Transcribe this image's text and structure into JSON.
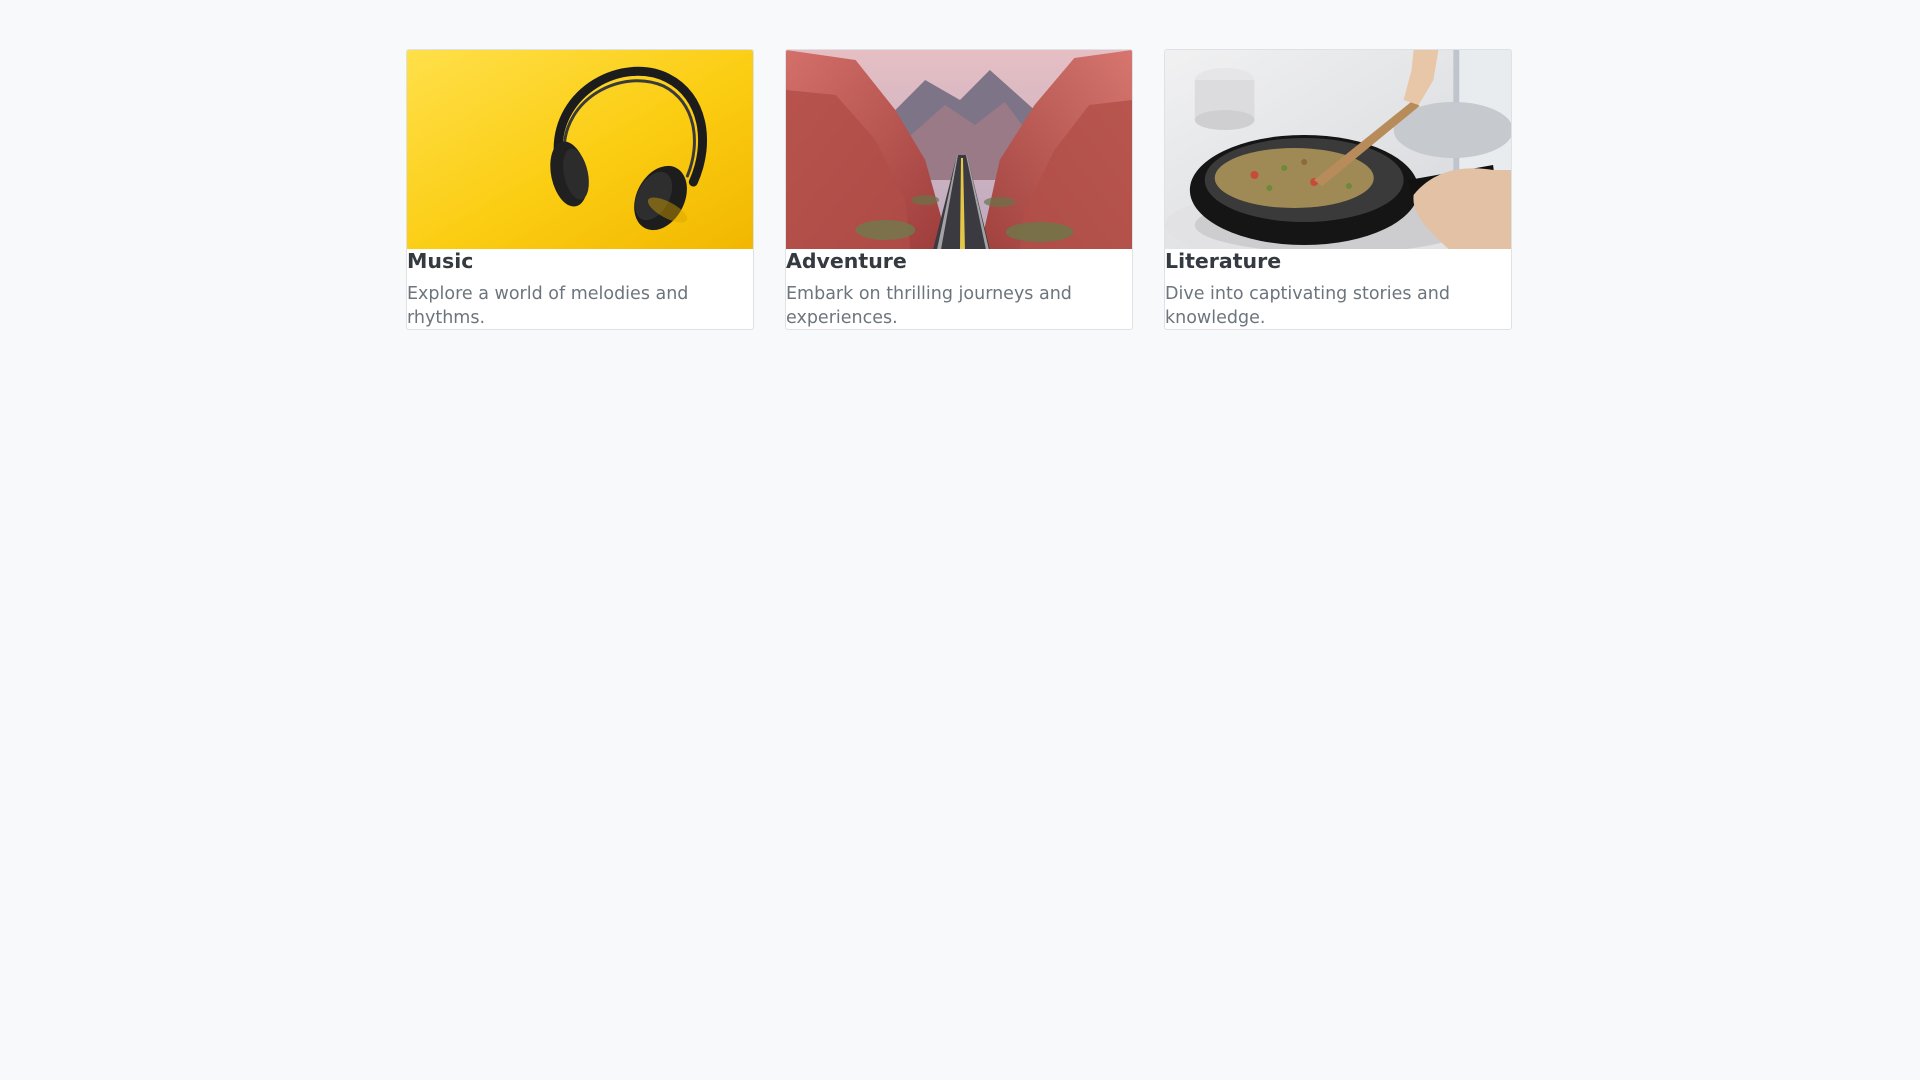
{
  "cards": [
    {
      "title": "Music",
      "description": "Explore a world of melodies and rhythms.",
      "image_icon": "headphones-icon",
      "accent": "#f9c400"
    },
    {
      "title": "Adventure",
      "description": "Embark on thrilling journeys and experiences.",
      "image_icon": "mountain-road-icon",
      "accent": "#c2524c"
    },
    {
      "title": "Literature",
      "description": "Dive into captivating stories and knowledge.",
      "image_icon": "frying-pan-icon",
      "accent": "#e8e8ea"
    }
  ]
}
